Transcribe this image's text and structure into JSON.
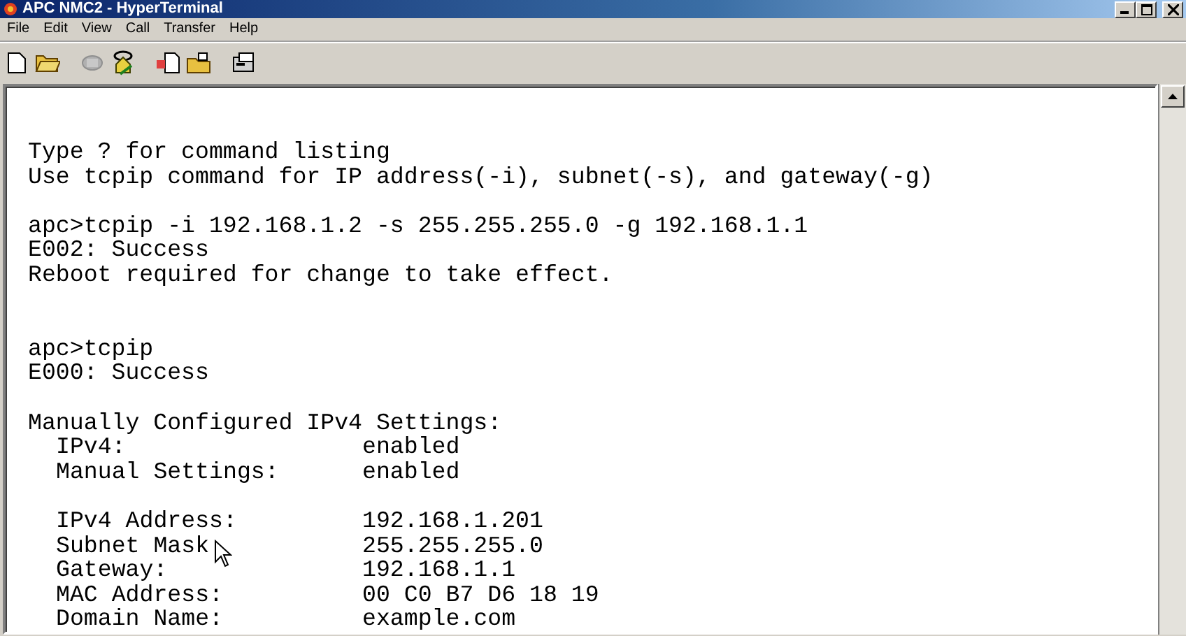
{
  "window": {
    "title": "APC NMC2 - HyperTerminal"
  },
  "menu": [
    "File",
    "Edit",
    "View",
    "Call",
    "Transfer",
    "Help"
  ],
  "terminal": {
    "blocks": [
      {
        "kind": "text",
        "lines": [
          "Type ? for command listing",
          "Use tcpip command for IP address(-i), subnet(-s), and gateway(-g)"
        ]
      },
      {
        "kind": "text",
        "lines": [
          "apc>tcpip -i 192.168.1.2 -s 255.255.255.0 -g 192.168.1.1",
          "E002: Success",
          "Reboot required for change to take effect."
        ]
      },
      {
        "kind": "text",
        "lines": [
          "apc>tcpip",
          "E000: Success"
        ]
      },
      {
        "kind": "fields",
        "heading": "Manually Configured IPv4 Settings:",
        "rows": [
          {
            "label": "IPv4:",
            "value": "enabled"
          },
          {
            "label": "Manual Settings:",
            "value": "enabled"
          }
        ]
      },
      {
        "kind": "fields",
        "rows": [
          {
            "label": "IPv4 Address:",
            "value": "192.168.1.201"
          },
          {
            "label": "Subnet Mask",
            "value": "255.255.255.0"
          },
          {
            "label": "Gateway:",
            "value": "192.168.1.1"
          },
          {
            "label": "MAC Address:",
            "value": "00 C0 B7 D6 18 19"
          },
          {
            "label": "Domain Name:",
            "value": "example.com"
          }
        ]
      }
    ]
  }
}
